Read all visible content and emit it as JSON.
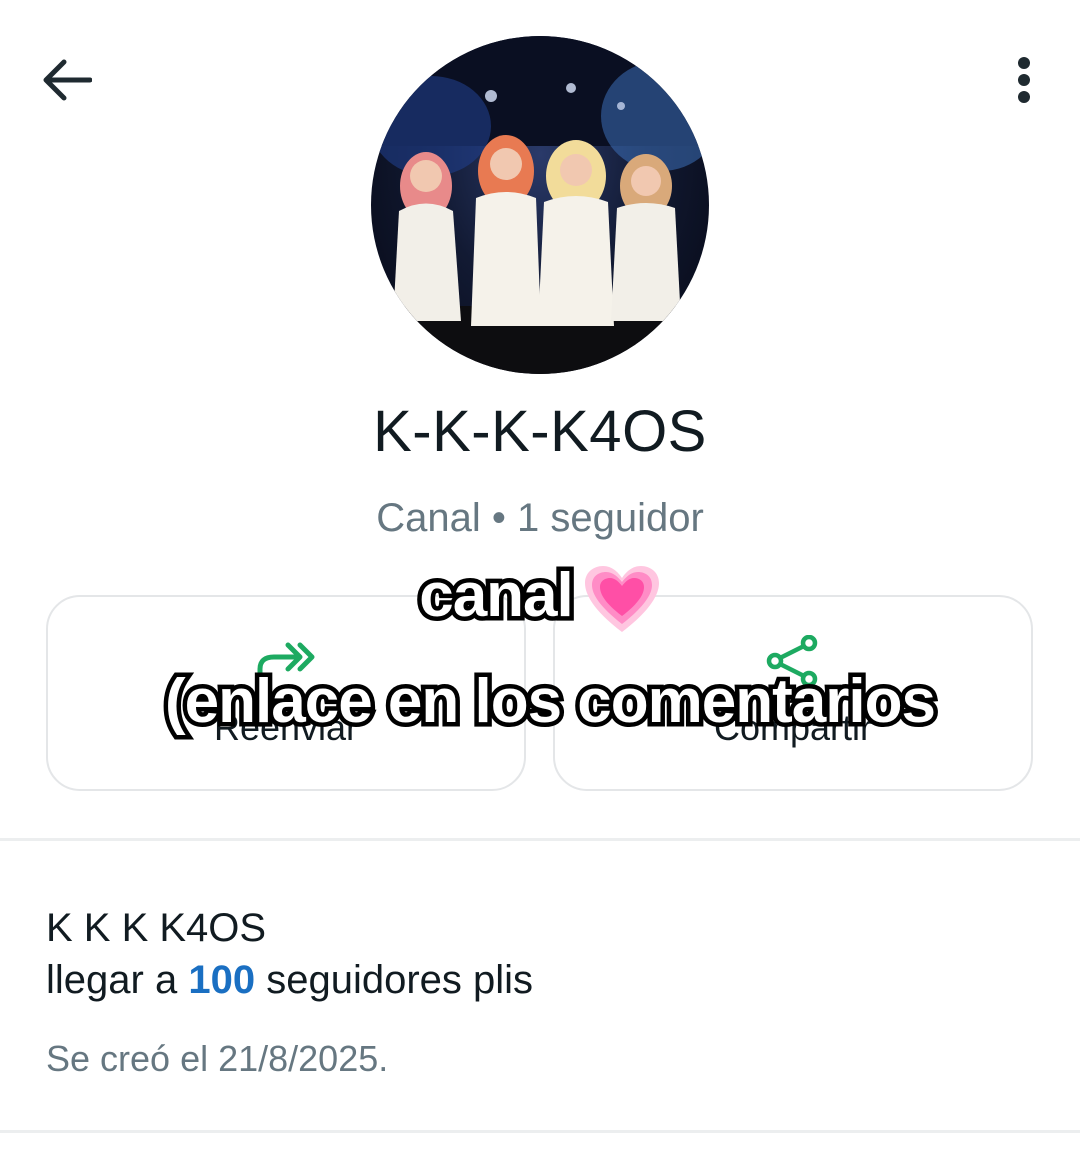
{
  "header": {
    "back_icon": "arrow-left-icon",
    "menu_icon": "more-vertical-icon"
  },
  "channel": {
    "name": "K-K-K-K4OS",
    "type": "Canal",
    "separator": "•",
    "followers": "1 seguidor",
    "avatar_description": "channel-avatar"
  },
  "actions": [
    {
      "label": "Reenviar",
      "icon": "forward-icon",
      "color": "#1daa61"
    },
    {
      "label": "Compartir",
      "icon": "share-icon",
      "color": "#1daa61"
    }
  ],
  "overlay": {
    "line1": "canal",
    "line2": "(enlace en los comentarios",
    "emoji": "growing-heart-emoji"
  },
  "description": {
    "title": "K K K K4OS",
    "line2_prefix": "llegar a",
    "line2_number": "100",
    "line2_suffix": "seguidores plis",
    "created": "Se creó el 21/8/2025."
  },
  "colors": {
    "accent_green": "#1daa61",
    "link_blue": "#1a6fc2",
    "secondary_text": "#667781"
  }
}
